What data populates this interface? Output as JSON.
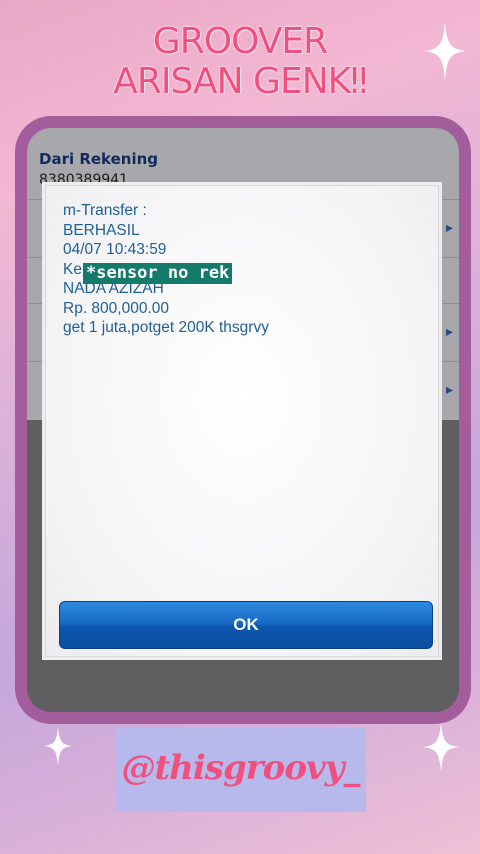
{
  "header": {
    "title_line1": "GROOVER",
    "title_line2": "ARISAN GENK‼"
  },
  "background_app": {
    "from_label": "Dari Rekening",
    "from_value": "8380389941"
  },
  "dialog": {
    "lines": [
      "m-Transfer :",
      "BERHASIL",
      "04/07 10:43:59",
      "Ke",
      "NADA AZIZAH",
      "Rp. 800,000.00",
      "get 1 juta,potget 200K thsgrvy"
    ],
    "censor_text": "*sensor no rek",
    "ok_label": "OK"
  },
  "footer": {
    "handle": "@thisgroovy_"
  },
  "colors": {
    "title_pink": "#f0507e",
    "phone_frame": "#a45d9c",
    "message_text": "#1f5f96",
    "censor_bg": "#137a6c",
    "ok_button": "#1667c3",
    "handle_box": "#b7b9ec"
  },
  "icons": {
    "sparkle": "four-point-star",
    "row_arrow": "chevron-right"
  }
}
